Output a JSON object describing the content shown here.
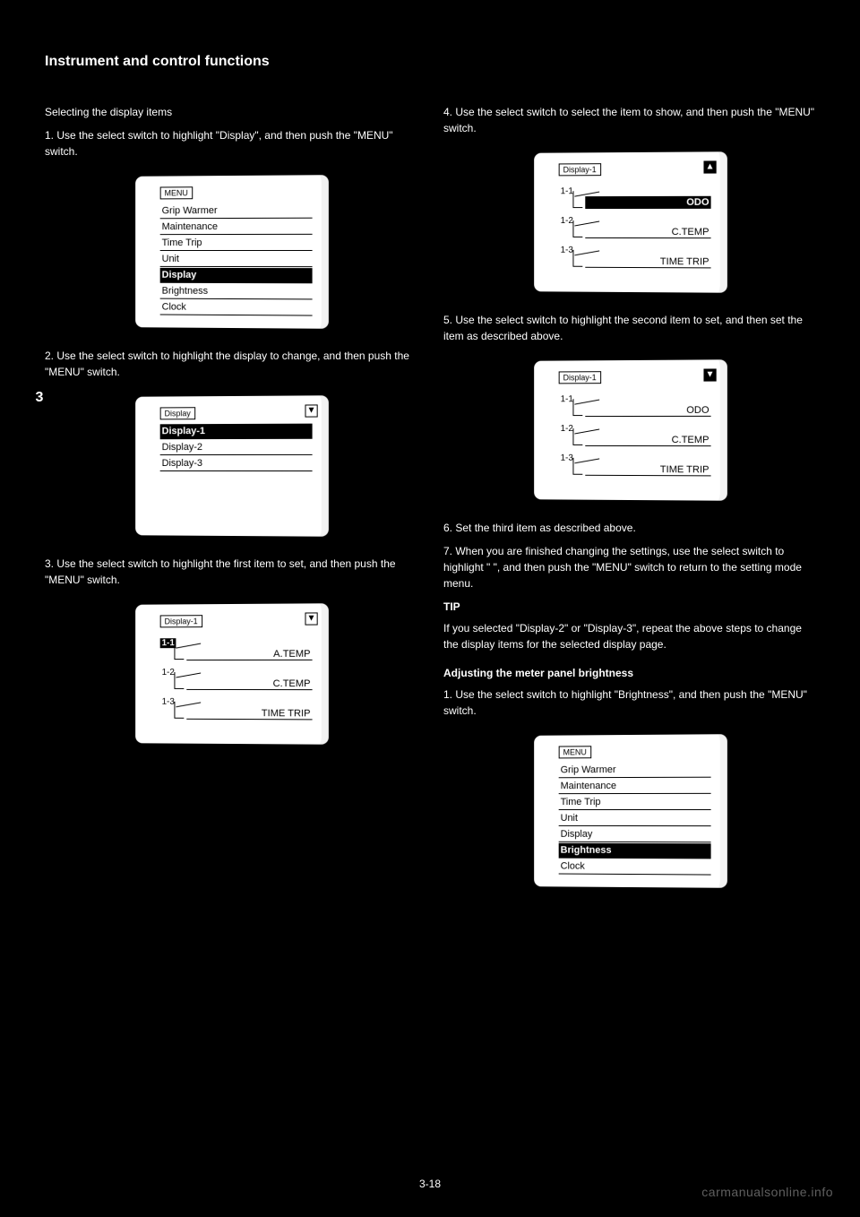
{
  "header": "Instrument and control functions",
  "side_tab": "3",
  "page_number": "3-18",
  "watermark": "carmanualsonline.info",
  "left": {
    "p1": "Selecting the display items",
    "p2": "1. Use the select switch to highlight \"Display\", and then push the \"MENU\" switch.",
    "fig1": {
      "tag": "MENU",
      "items": [
        "Grip Warmer",
        "Maintenance",
        "Time Trip",
        "Unit",
        "Display",
        "Brightness",
        "Clock"
      ],
      "selected_index": 4
    },
    "p3": "2. Use the select switch to highlight the display to change, and then push the \"MENU\" switch.",
    "fig2": {
      "tag": "Display",
      "arrow": "down",
      "items": [
        "Display-1",
        "Display-2",
        "Display-3"
      ],
      "selected_index": 0
    },
    "p4": "3. Use the select switch to highlight the first item to set, and then push the \"MENU\" switch.",
    "fig3": {
      "tag": "Display-1",
      "arrow": "down",
      "slots": [
        {
          "num": "1-1",
          "num_sel": true,
          "val": "A.TEMP",
          "val_sel": false
        },
        {
          "num": "1-2",
          "num_sel": false,
          "val": "C.TEMP",
          "val_sel": false
        },
        {
          "num": "1-3",
          "num_sel": false,
          "val": "TIME TRIP",
          "val_sel": false
        }
      ]
    }
  },
  "right": {
    "p1": "4. Use the select switch to select the item to show, and then push the \"MENU\" switch.",
    "fig1": {
      "tag": "Display-1",
      "arrow": "up",
      "arrow_filled": true,
      "slots": [
        {
          "num": "1-1",
          "num_sel": false,
          "val": "ODO",
          "val_sel": true
        },
        {
          "num": "1-2",
          "num_sel": false,
          "val": "C.TEMP",
          "val_sel": false
        },
        {
          "num": "1-3",
          "num_sel": false,
          "val": "TIME TRIP",
          "val_sel": false
        }
      ]
    },
    "p2": "5. Use the select switch to highlight the second item to set, and then set the item as described above.",
    "fig2": {
      "tag": "Display-1",
      "arrow": "down",
      "arrow_filled": true,
      "slots": [
        {
          "num": "1-1",
          "num_sel": false,
          "val": "ODO",
          "val_sel": false
        },
        {
          "num": "1-2",
          "num_sel": false,
          "val": "C.TEMP",
          "val_sel": false
        },
        {
          "num": "1-3",
          "num_sel": false,
          "val": "TIME TRIP",
          "val_sel": false
        }
      ]
    },
    "p3": "6. Set the third item as described above.",
    "p4": "7. When you are finished changing the settings, use the select switch to highlight \"  \", and then push the \"MENU\" switch to return to the setting mode menu.",
    "tip_label": "TIP",
    "tip_text": "If you selected \"Display-2\" or \"Display-3\", repeat the above steps to change the display items for the selected display page.",
    "section": "Adjusting the meter panel brightness",
    "p5": "1. Use the select switch to highlight \"Brightness\", and then push the \"MENU\" switch.",
    "fig3": {
      "tag": "MENU",
      "items": [
        "Grip Warmer",
        "Maintenance",
        "Time Trip",
        "Unit",
        "Display",
        "Brightness",
        "Clock"
      ],
      "selected_index": 5
    }
  }
}
